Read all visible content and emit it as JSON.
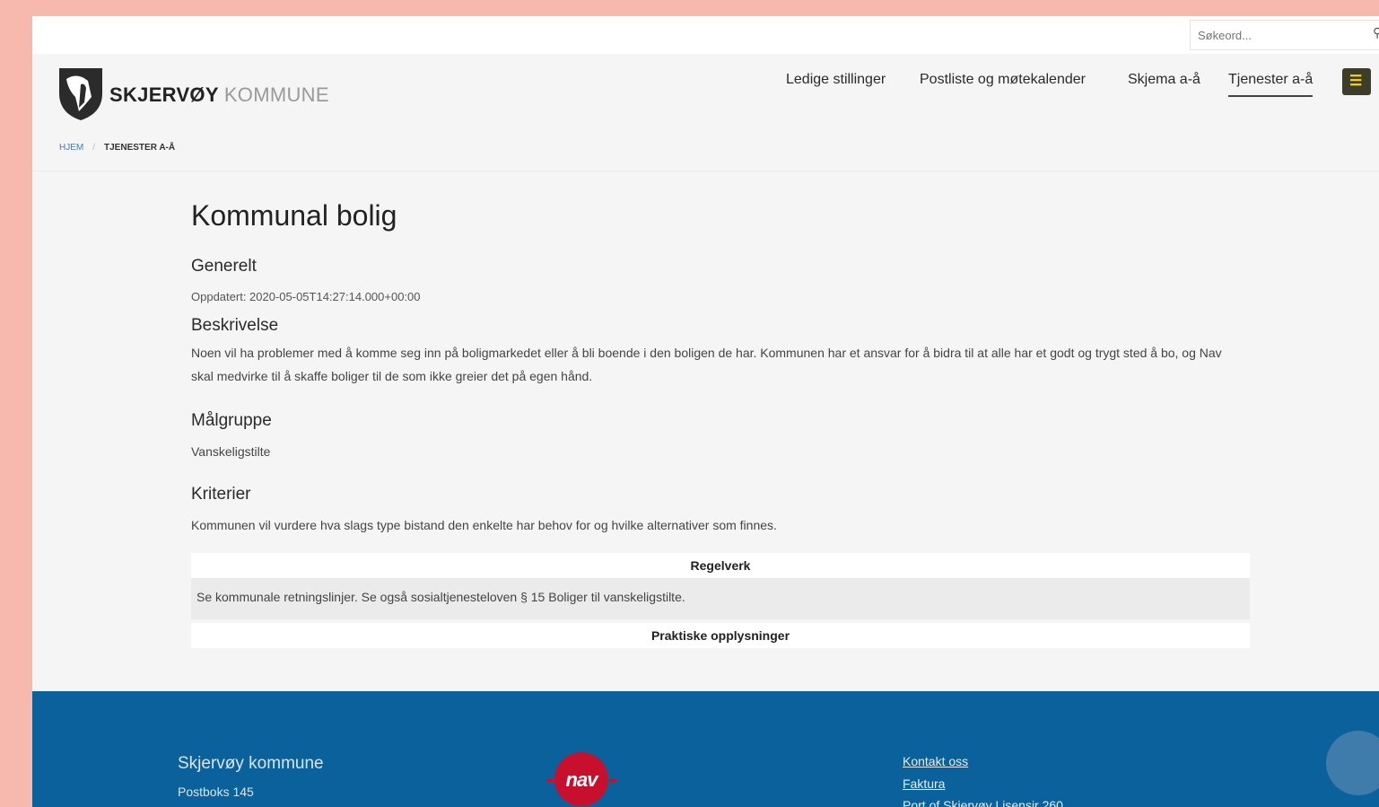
{
  "search": {
    "placeholder": "Søkeord..."
  },
  "brand": {
    "name_bold": "SKJERVØY",
    "name_light": "KOMMUNE"
  },
  "nav": {
    "items": [
      {
        "label": "Ledige stillinger"
      },
      {
        "label": "Postliste og møtekalender"
      },
      {
        "label": "Skjema a-å"
      },
      {
        "label": "Tjenester a-å",
        "active": true
      }
    ]
  },
  "breadcrumb": {
    "home": "HJEM",
    "current": "TJENESTER A-Å"
  },
  "page": {
    "title": "Kommunal bolig",
    "generelt_heading": "Generelt",
    "updated": "Oppdatert: 2020-05-05T14:27:14.000+00:00",
    "beskrivelse_heading": "Beskrivelse",
    "beskrivelse_text": "Noen vil ha problemer med å komme seg inn på boligmarkedet eller å bli boende i den boligen de har. Kommunen har et ansvar for å bidra til at alle har et godt og trygt sted å bo, og Nav skal medvirke til å skaffe boliger til de som ikke greier det på egen hånd.",
    "malgruppe_heading": "Målgruppe",
    "malgruppe_text": "Vanskeligstilte",
    "kriterier_heading": "Kriterier",
    "kriterier_text": "Kommunen vil vurdere hva slags type bistand den enkelte har behov for og hvilke alternativer som finnes.",
    "regelverk_heading": "Regelverk",
    "regelverk_text": "Se kommunale retningslinjer. Se også sosialtjenesteloven § 15 Boliger til vanskeligstilte.",
    "praktiske_heading": "Praktiske opplysninger"
  },
  "footer": {
    "org_name": "Skjervøy kommune",
    "address": "Postboks 145",
    "nav_logo_text": "nav",
    "links": [
      "Kontakt oss",
      "Faktura",
      "Port of Skjervøy Lisensir 260"
    ]
  },
  "colors": {
    "background": "#f7b8ad",
    "footer": "#0b619c",
    "nav_red": "#c8102e",
    "menu_button": "#3d3d2a",
    "menu_icon": "#ffd21f"
  }
}
